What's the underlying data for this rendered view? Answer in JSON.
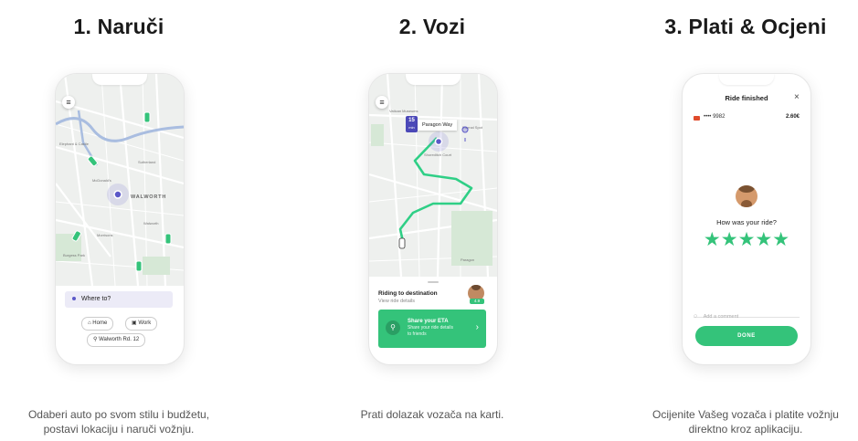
{
  "colors": {
    "accent": "#34c37a",
    "purple": "#5b58c8",
    "map_bg": "#eef0ee",
    "route": "#2fcf86"
  },
  "step1": {
    "title": "1. Naruči",
    "caption_line1": "Odaberi auto po svom stilu i budžetu,",
    "caption_line2": "postavi lokaciju i naruči vožnju.",
    "map_label_walworth": "WALWORTH",
    "where_to": "Where to?",
    "chip_home": "Home",
    "chip_work": "Work",
    "chip_walworth": "Walworth Rd. 12",
    "icons": [
      "menu-icon",
      "home-icon",
      "work-icon",
      "location-pin-icon"
    ]
  },
  "step2": {
    "title": "2. Vozi",
    "caption_line1": "Prati dolazak vozača na karti.",
    "eta_minutes": "15",
    "eta_unit": "min",
    "street_tag": "Paragon Way",
    "riding": "Riding to destination",
    "view_details": "View ride details",
    "rating": "4.9",
    "share_title": "Share your ETA",
    "share_sub1": "Share your ride details",
    "share_sub2": "to friends",
    "icons": [
      "menu-icon",
      "location-pin-icon",
      "chevron-right-icon"
    ]
  },
  "step3": {
    "title": "3. Plati & Ocjeni",
    "caption_line1": "Ocijenite Vašeg vozača i platite vožnju",
    "caption_line2": "direktno kroz aplikaciju.",
    "ride_finished": "Ride finished",
    "close": "×",
    "card": "•••• 9982",
    "amount": "2.60€",
    "question": "How was your ride?",
    "stars": 5,
    "comment": "Add a comment",
    "done": "DONE",
    "icons": [
      "close-icon",
      "card-icon",
      "star-icon",
      "comment-icon"
    ]
  }
}
